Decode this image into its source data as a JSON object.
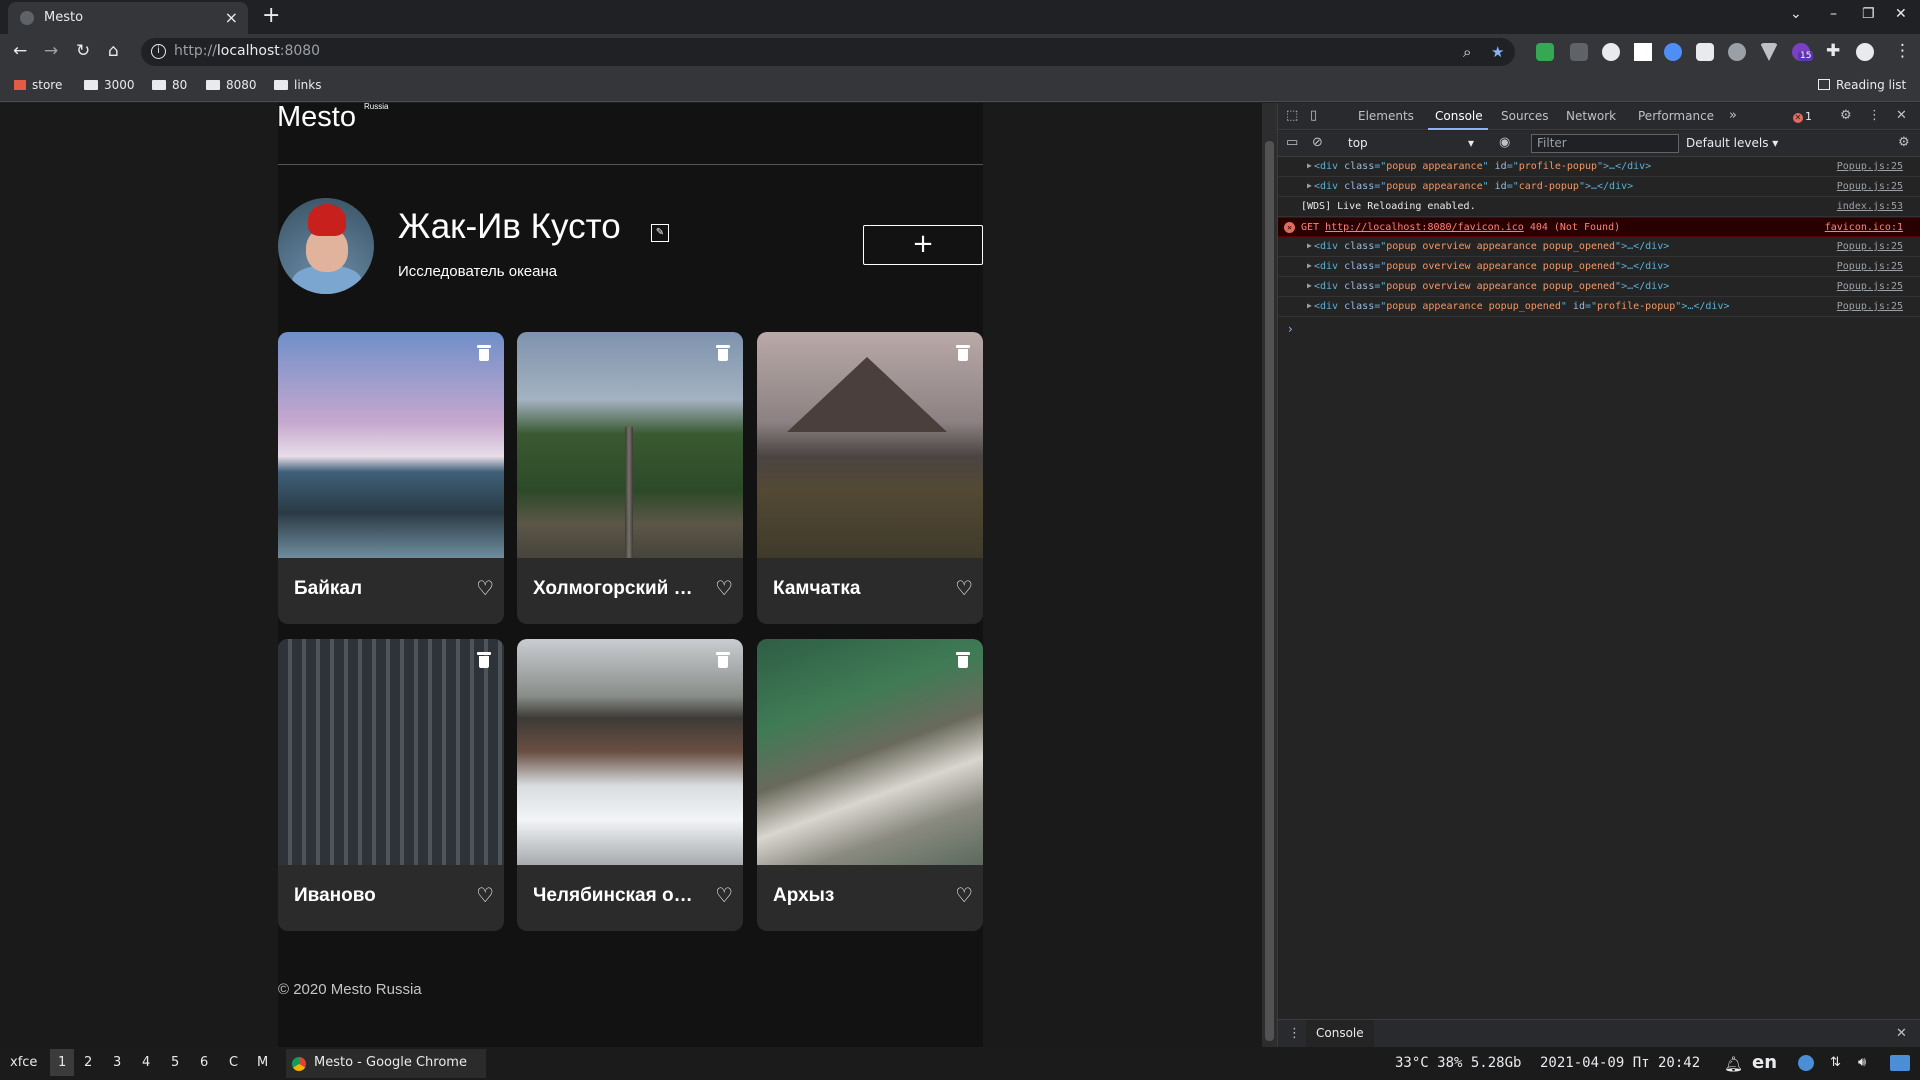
{
  "browser": {
    "tab_title": "Mesto",
    "url_scheme": "http://",
    "url_host": "localhost",
    "url_port": ":8080",
    "bookmarks": [
      "store",
      "3000",
      "80",
      "8080",
      "links"
    ],
    "reading_list": "Reading list",
    "extension_badge": "15"
  },
  "page": {
    "logo": "Mesto",
    "logo_sup": "Russia",
    "profile_name": "Жак-Ив Кусто",
    "profile_job": "Исследователь океана",
    "add_label": "+",
    "footer": "© 2020 Mesto Russia",
    "cards": [
      {
        "title": "Байкал"
      },
      {
        "title": "Холмогорский р..."
      },
      {
        "title": "Камчатка"
      },
      {
        "title": "Иваново"
      },
      {
        "title": "Челябинская об..."
      },
      {
        "title": "Архыз"
      }
    ]
  },
  "devtools": {
    "tabs": [
      "Elements",
      "Console",
      "Sources",
      "Network",
      "Performance"
    ],
    "active_tab": "Console",
    "error_count": "1",
    "context": "top",
    "filter_placeholder": "Filter",
    "levels": "Default levels",
    "drawer_tab": "Console",
    "logs": [
      {
        "kind": "element",
        "cls": "popup appearance",
        "id": "profile-popup",
        "src": "Popup.js:25"
      },
      {
        "kind": "element",
        "cls": "popup appearance",
        "id": "card-popup",
        "src": "Popup.js:25"
      },
      {
        "kind": "text",
        "text": "[WDS] Live Reloading enabled.",
        "src": "index.js:53"
      },
      {
        "kind": "error",
        "method": "GET",
        "url": "http://localhost:8080/favicon.ico",
        "status": "404 (Not Found)",
        "src": "favicon.ico:1"
      },
      {
        "kind": "element",
        "cls": "popup overview appearance popup_opened",
        "src": "Popup.js:25"
      },
      {
        "kind": "element",
        "cls": "popup overview appearance popup_opened",
        "src": "Popup.js:25"
      },
      {
        "kind": "element",
        "cls": "popup overview appearance popup_opened",
        "src": "Popup.js:25"
      },
      {
        "kind": "element",
        "cls": "popup appearance popup_opened",
        "id": "profile-popup",
        "src": "Popup.js:25"
      }
    ]
  },
  "taskbar": {
    "menu": "xfce",
    "workspaces": [
      "1",
      "2",
      "3",
      "4",
      "5",
      "6",
      "C",
      "M"
    ],
    "active_workspace": "1",
    "task_title": "Mesto - Google Chrome",
    "status": "33°C 38% 5.28Gb",
    "datetime": "2021-04-09 Пт 20:42",
    "keyboard_layout": "en"
  },
  "colors": {
    "page_bg": "#121212",
    "card_bg": "#2b2b2b",
    "devtools_bg": "#242424",
    "error_bg": "#290000",
    "accent": "#8ab4f8"
  }
}
